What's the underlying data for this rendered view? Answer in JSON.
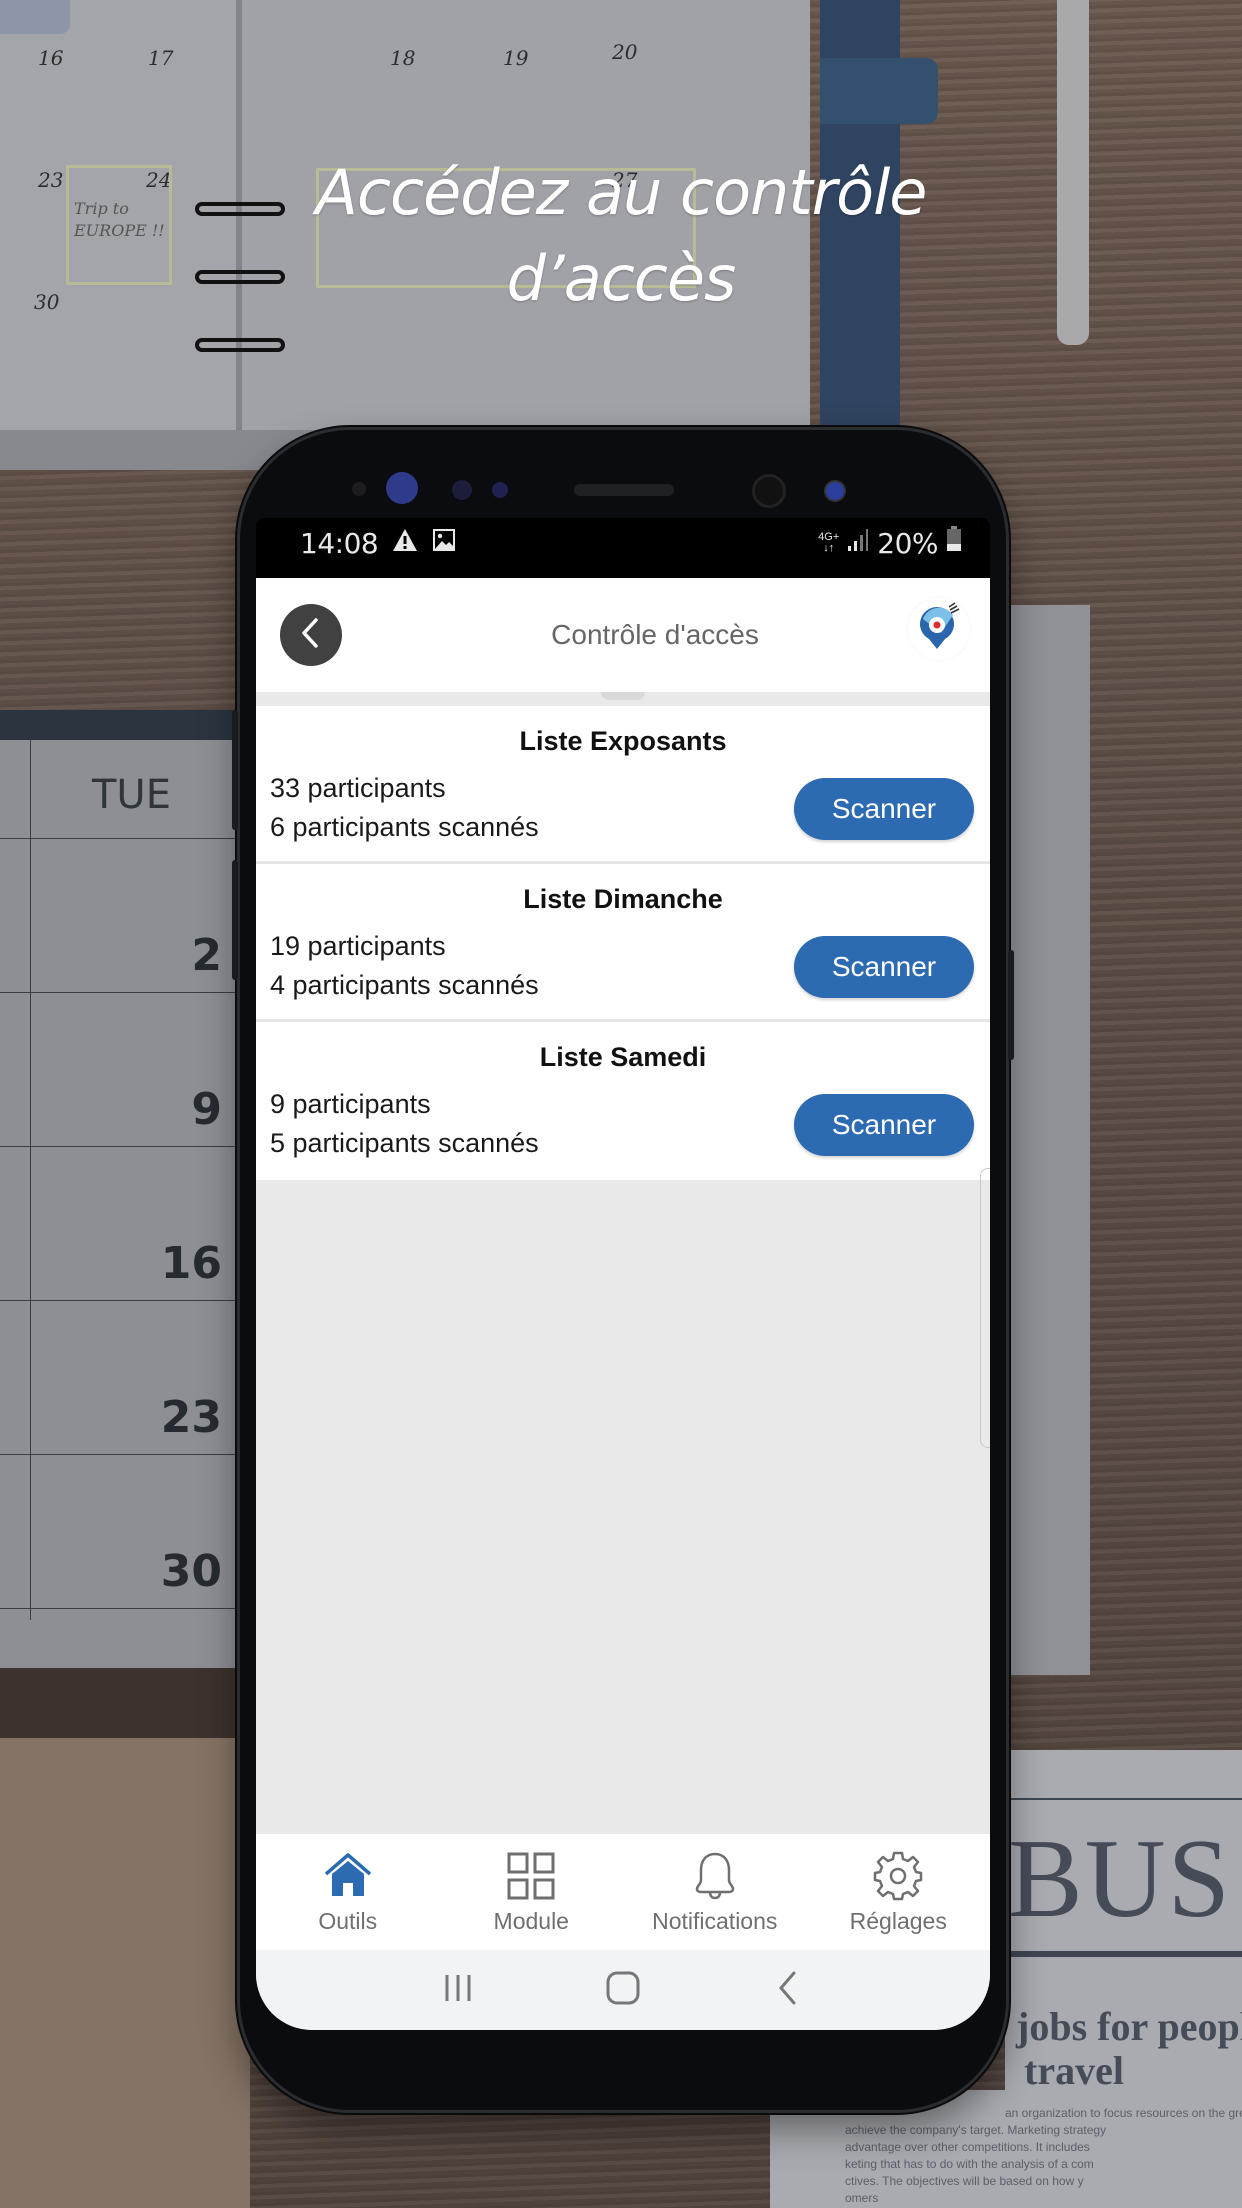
{
  "headline": {
    "line1": "Accédez au contrôle",
    "line2": "d’accès"
  },
  "background": {
    "planner_dates": [
      "16",
      "17",
      "18",
      "19",
      "20",
      "23",
      "24",
      "27",
      "30"
    ],
    "sticky_note": [
      "Trip to",
      "EUROPE !!"
    ],
    "calendar_day": "TUE",
    "calendar_numbers": [
      "2",
      "9",
      "16",
      "23",
      "30"
    ],
    "newspaper_masthead": "BUS",
    "newspaper_headline": [
      "jobs for people",
      "travel"
    ],
    "newspaper_body": [
      "an organization to focus resources on the greatest opportunities",
      "achieve the company's target. Marketing strategy",
      "advantage over other competitions. It includes",
      "keting that has to do with the analysis of a com",
      "ctives. The objectives will be based on how y",
      "omers"
    ]
  },
  "status_bar": {
    "time": "14:08",
    "left_icons": [
      "warning-icon",
      "image-icon"
    ],
    "network": "4G+",
    "battery": "20%"
  },
  "app_bar": {
    "title": "Contrôle d'accès",
    "back_icon": "chevron-left-icon",
    "logo_icon": "location-pin-logo-icon"
  },
  "lists": [
    {
      "title": "Liste Exposants",
      "participants": "33 participants",
      "scanned": "6 participants scannés",
      "button": "Scanner"
    },
    {
      "title": "Liste Dimanche",
      "participants": "19 participants",
      "scanned": "4 participants scannés",
      "button": "Scanner"
    },
    {
      "title": "Liste Samedi",
      "participants": "9 participants",
      "scanned": "5 participants scannés",
      "button": "Scanner"
    }
  ],
  "tab_bar": {
    "active": "Outils",
    "tabs": [
      {
        "label": "Outils",
        "icon": "home-icon"
      },
      {
        "label": "Module",
        "icon": "grid-icon"
      },
      {
        "label": "Notifications",
        "icon": "bell-icon"
      },
      {
        "label": "Réglages",
        "icon": "gear-icon"
      }
    ]
  },
  "system_nav": {
    "buttons": [
      "recent-apps-icon",
      "home-button-icon",
      "back-icon"
    ]
  },
  "colors": {
    "accent": "#2c6ab1",
    "back_button": "#414141",
    "content_bg": "#e9e9ea",
    "tab_label": "#6f6f6f"
  }
}
